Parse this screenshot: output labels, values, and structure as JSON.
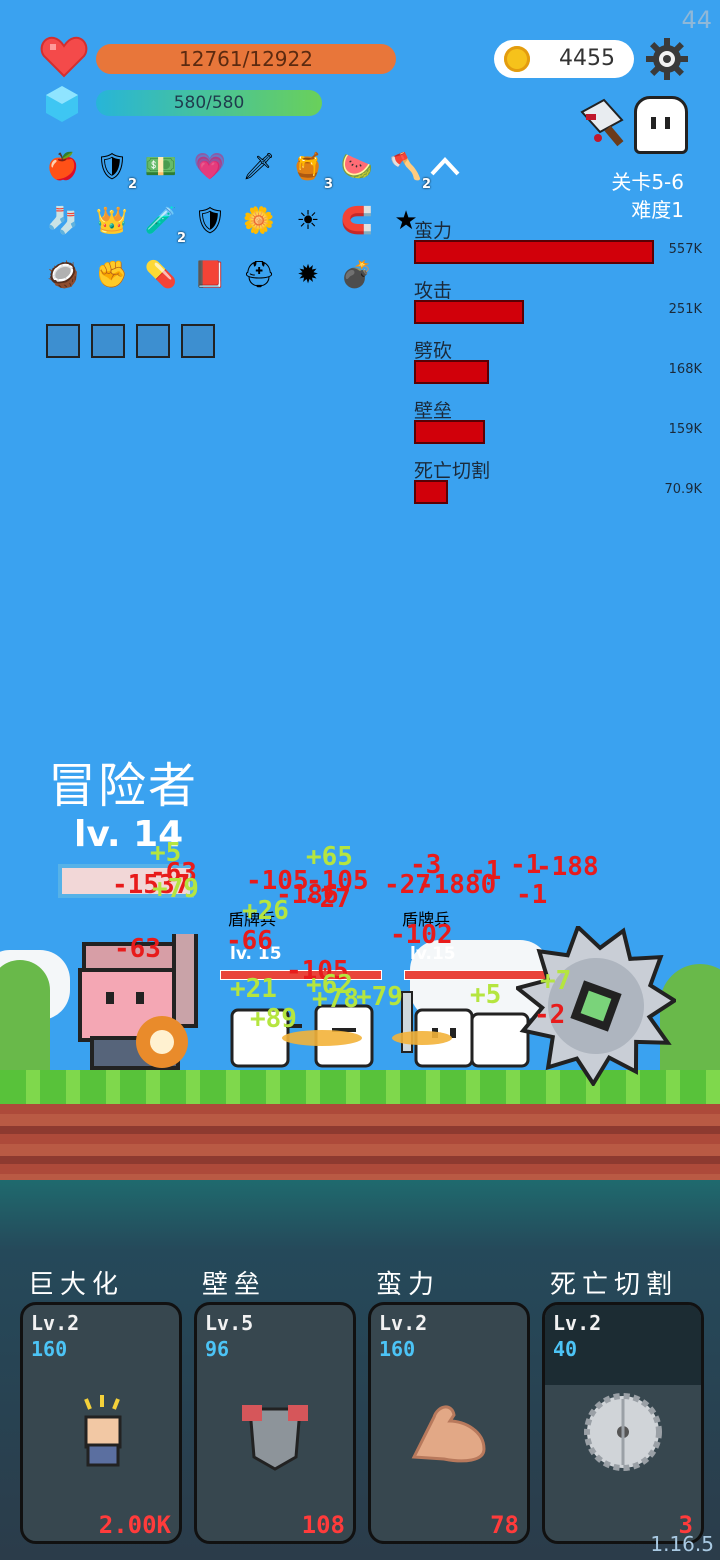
{
  "fps": "44",
  "version": "1.16.5",
  "player": {
    "hp": "12761/12922",
    "mp": "580/580",
    "class_name": "冒险者",
    "level": "lv. 14",
    "hp_fraction": 0.98
  },
  "currency": {
    "coins": "4455"
  },
  "stage": {
    "stage": "关卡5-6",
    "difficulty": "难度1"
  },
  "items_row1": [
    {
      "icon": "apple-icon",
      "count": ""
    },
    {
      "icon": "shield-round-icon",
      "count": "2"
    },
    {
      "icon": "money-heart-icon",
      "count": ""
    },
    {
      "icon": "heart-card-icon",
      "count": ""
    },
    {
      "icon": "sword-icon",
      "count": ""
    },
    {
      "icon": "jam-jar-icon",
      "count": "3"
    },
    {
      "icon": "watermelon-icon",
      "count": ""
    },
    {
      "icon": "battle-axe-icon",
      "count": "2"
    }
  ],
  "items_row2": [
    {
      "icon": "sock-icon",
      "count": ""
    },
    {
      "icon": "crown-icon",
      "count": ""
    },
    {
      "icon": "potion-icon",
      "count": "2"
    },
    {
      "icon": "shield-icon",
      "count": ""
    },
    {
      "icon": "flower-icon",
      "count": ""
    },
    {
      "icon": "sun-icon",
      "count": ""
    },
    {
      "icon": "magnet-icon",
      "count": ""
    },
    {
      "icon": "star-card-icon",
      "count": ""
    }
  ],
  "items_row3": [
    {
      "icon": "coconut-icon",
      "count": ""
    },
    {
      "icon": "fist-icon",
      "count": ""
    },
    {
      "icon": "pill-icon",
      "count": ""
    },
    {
      "icon": "book-icon",
      "count": ""
    },
    {
      "icon": "helmet-icon",
      "count": ""
    },
    {
      "icon": "mace-icon",
      "count": ""
    },
    {
      "icon": "grenade-icon",
      "count": ""
    }
  ],
  "buffs": [
    "lightbulb-buff-icon",
    "checkmark-buff-icon",
    "armor-buff-icon",
    "cloud-buff-icon"
  ],
  "damage_stats": [
    {
      "label": "蛮力",
      "value": "557K",
      "fraction": 1.0
    },
    {
      "label": "攻击",
      "value": "251K",
      "fraction": 0.45
    },
    {
      "label": "劈砍",
      "value": "168K",
      "fraction": 0.3
    },
    {
      "label": "壁垒",
      "value": "159K",
      "fraction": 0.285
    },
    {
      "label": "死亡切割",
      "value": "70.9K",
      "fraction": 0.127
    }
  ],
  "enemies": [
    {
      "name": "盾牌兵",
      "level": "lv. 15"
    },
    {
      "name": "盾牌兵",
      "level": "lv.15"
    }
  ],
  "floating_numbers": [
    "+5",
    "-63",
    "-1537",
    "+79",
    "+65",
    "-105",
    "-105",
    "-3",
    "-1",
    "-1",
    "-188",
    "-186",
    "-27",
    "-27",
    "-1880",
    "-66",
    "-105",
    "+62",
    "-63",
    "+26",
    "+21",
    "+89",
    "+78",
    "+79",
    "-102",
    "+5",
    "-2",
    "+7",
    "-1"
  ],
  "skills": [
    {
      "title": "巨大化",
      "level": "Lv.2",
      "cost": "160",
      "damage": "2.00K",
      "icon": "fist-raise-icon",
      "cooldown": false
    },
    {
      "title": "壁垒",
      "level": "Lv.5",
      "cost": "96",
      "damage": "108",
      "icon": "armor-icon",
      "cooldown": false
    },
    {
      "title": "蛮力",
      "level": "Lv.2",
      "cost": "160",
      "damage": "78",
      "icon": "muscle-arm-icon",
      "cooldown": false
    },
    {
      "title": "死亡切割",
      "level": "Lv.2",
      "cost": "40",
      "damage": "3",
      "icon": "saw-blade-icon",
      "cooldown": true
    }
  ]
}
